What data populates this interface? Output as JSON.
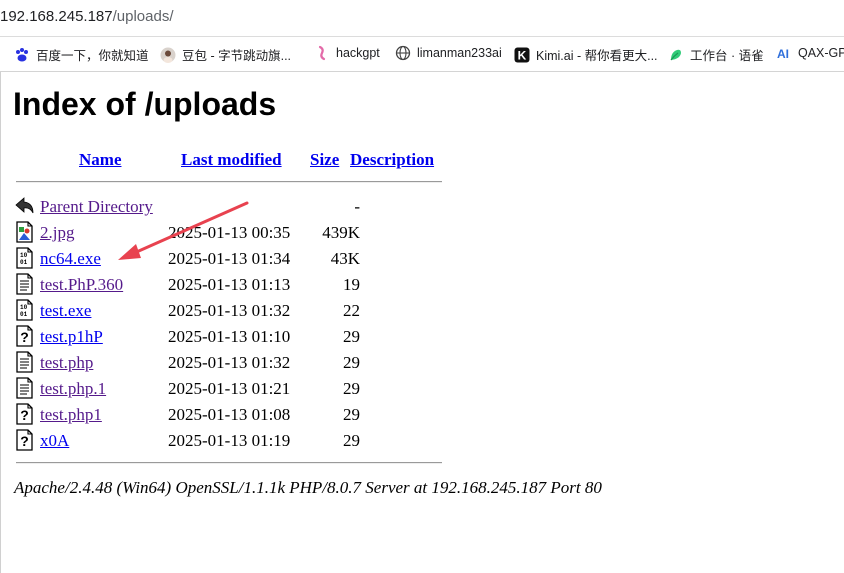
{
  "browser": {
    "url_host": "192.168.245.187",
    "url_path": "/uploads/",
    "bookmarks": [
      {
        "label": "百度一下，你就知道",
        "icon": "baidu-paw-icon"
      },
      {
        "label": "豆包 - 字节跳动旗...",
        "icon": "doubao-avatar-icon"
      },
      {
        "label": "hackgpt",
        "icon": "hackgpt-icon"
      },
      {
        "label": "limanman233ai",
        "icon": "globe-icon"
      },
      {
        "label": "Kimi.ai - 帮你看更大...",
        "icon": "kimi-icon"
      },
      {
        "label": "工作台 · 语雀",
        "icon": "yuque-icon"
      },
      {
        "label": "QAX-GPT",
        "icon": "qax-ai-icon"
      }
    ]
  },
  "page": {
    "title": "Index of /uploads",
    "columns": {
      "name": "Name",
      "last_modified": "Last modified",
      "size": "Size",
      "description": "Description"
    },
    "rows": [
      {
        "name": "Parent Directory",
        "date": "",
        "size": "-",
        "icon": "back-arrow-icon",
        "visited": true
      },
      {
        "name": "2.jpg",
        "date": "2025-01-13 00:35",
        "size": "439K",
        "icon": "image-file-icon",
        "visited": true
      },
      {
        "name": "nc64.exe",
        "date": "2025-01-13 01:34",
        "size": "43K",
        "icon": "binary-file-icon",
        "visited": false
      },
      {
        "name": "test.PhP.360",
        "date": "2025-01-13 01:13",
        "size": "19",
        "icon": "text-file-icon",
        "visited": true
      },
      {
        "name": "test.exe",
        "date": "2025-01-13 01:32",
        "size": "22",
        "icon": "binary-file-icon",
        "visited": false
      },
      {
        "name": "test.p1hP",
        "date": "2025-01-13 01:10",
        "size": "29",
        "icon": "unknown-file-icon",
        "visited": false
      },
      {
        "name": "test.php",
        "date": "2025-01-13 01:32",
        "size": "29",
        "icon": "text-file-icon",
        "visited": true
      },
      {
        "name": "test.php.1",
        "date": "2025-01-13 01:21",
        "size": "29",
        "icon": "text-file-icon",
        "visited": true
      },
      {
        "name": "test.php1",
        "date": "2025-01-13 01:08",
        "size": "29",
        "icon": "unknown-file-icon",
        "visited": true
      },
      {
        "name": "x0A",
        "date": "2025-01-13 01:19",
        "size": "29",
        "icon": "unknown-file-icon",
        "visited": false
      }
    ],
    "server_signature": "Apache/2.4.48 (Win64) OpenSSL/1.1.1k PHP/8.0.7 Server at 192.168.245.187 Port 80"
  },
  "colors": {
    "link": "#0000ee",
    "visited_link": "#551a8b",
    "annotation_arrow": "#e8424f"
  }
}
